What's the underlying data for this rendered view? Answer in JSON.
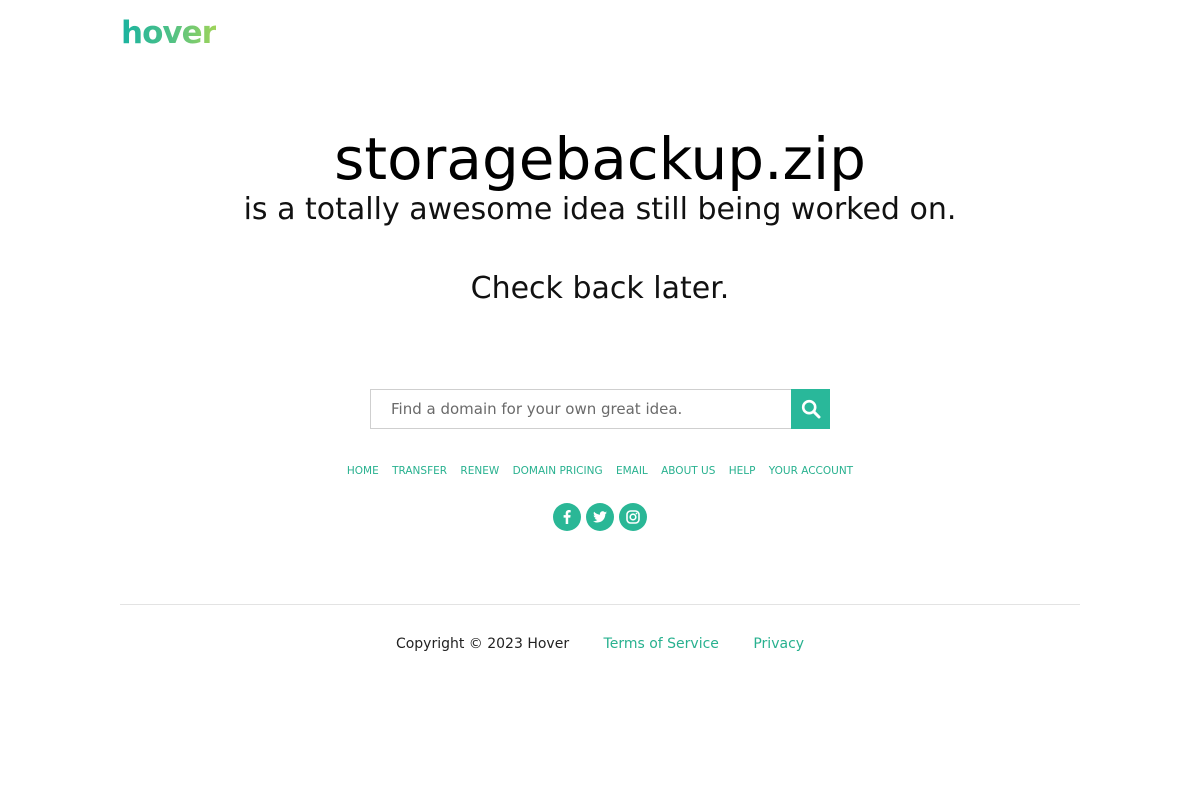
{
  "header": {
    "logo_text": "hover"
  },
  "hero": {
    "domain": "storagebackup.zip",
    "tagline": "is a totally awesome idea still being worked on.",
    "check_back": "Check back later."
  },
  "search": {
    "placeholder": "Find a domain for your own great idea.",
    "button_icon": "search-icon"
  },
  "nav": {
    "items": [
      {
        "label": "HOME"
      },
      {
        "label": "TRANSFER"
      },
      {
        "label": "RENEW"
      },
      {
        "label": "DOMAIN PRICING"
      },
      {
        "label": "EMAIL"
      },
      {
        "label": "ABOUT US"
      },
      {
        "label": "HELP"
      },
      {
        "label": "YOUR ACCOUNT"
      }
    ]
  },
  "social": {
    "icons": [
      "facebook-icon",
      "twitter-icon",
      "instagram-icon"
    ]
  },
  "footer": {
    "copyright": "Copyright © 2023 Hover",
    "terms_label": "Terms of Service",
    "privacy_label": "Privacy"
  },
  "colors": {
    "accent": "#29b89a",
    "text": "#111111"
  }
}
